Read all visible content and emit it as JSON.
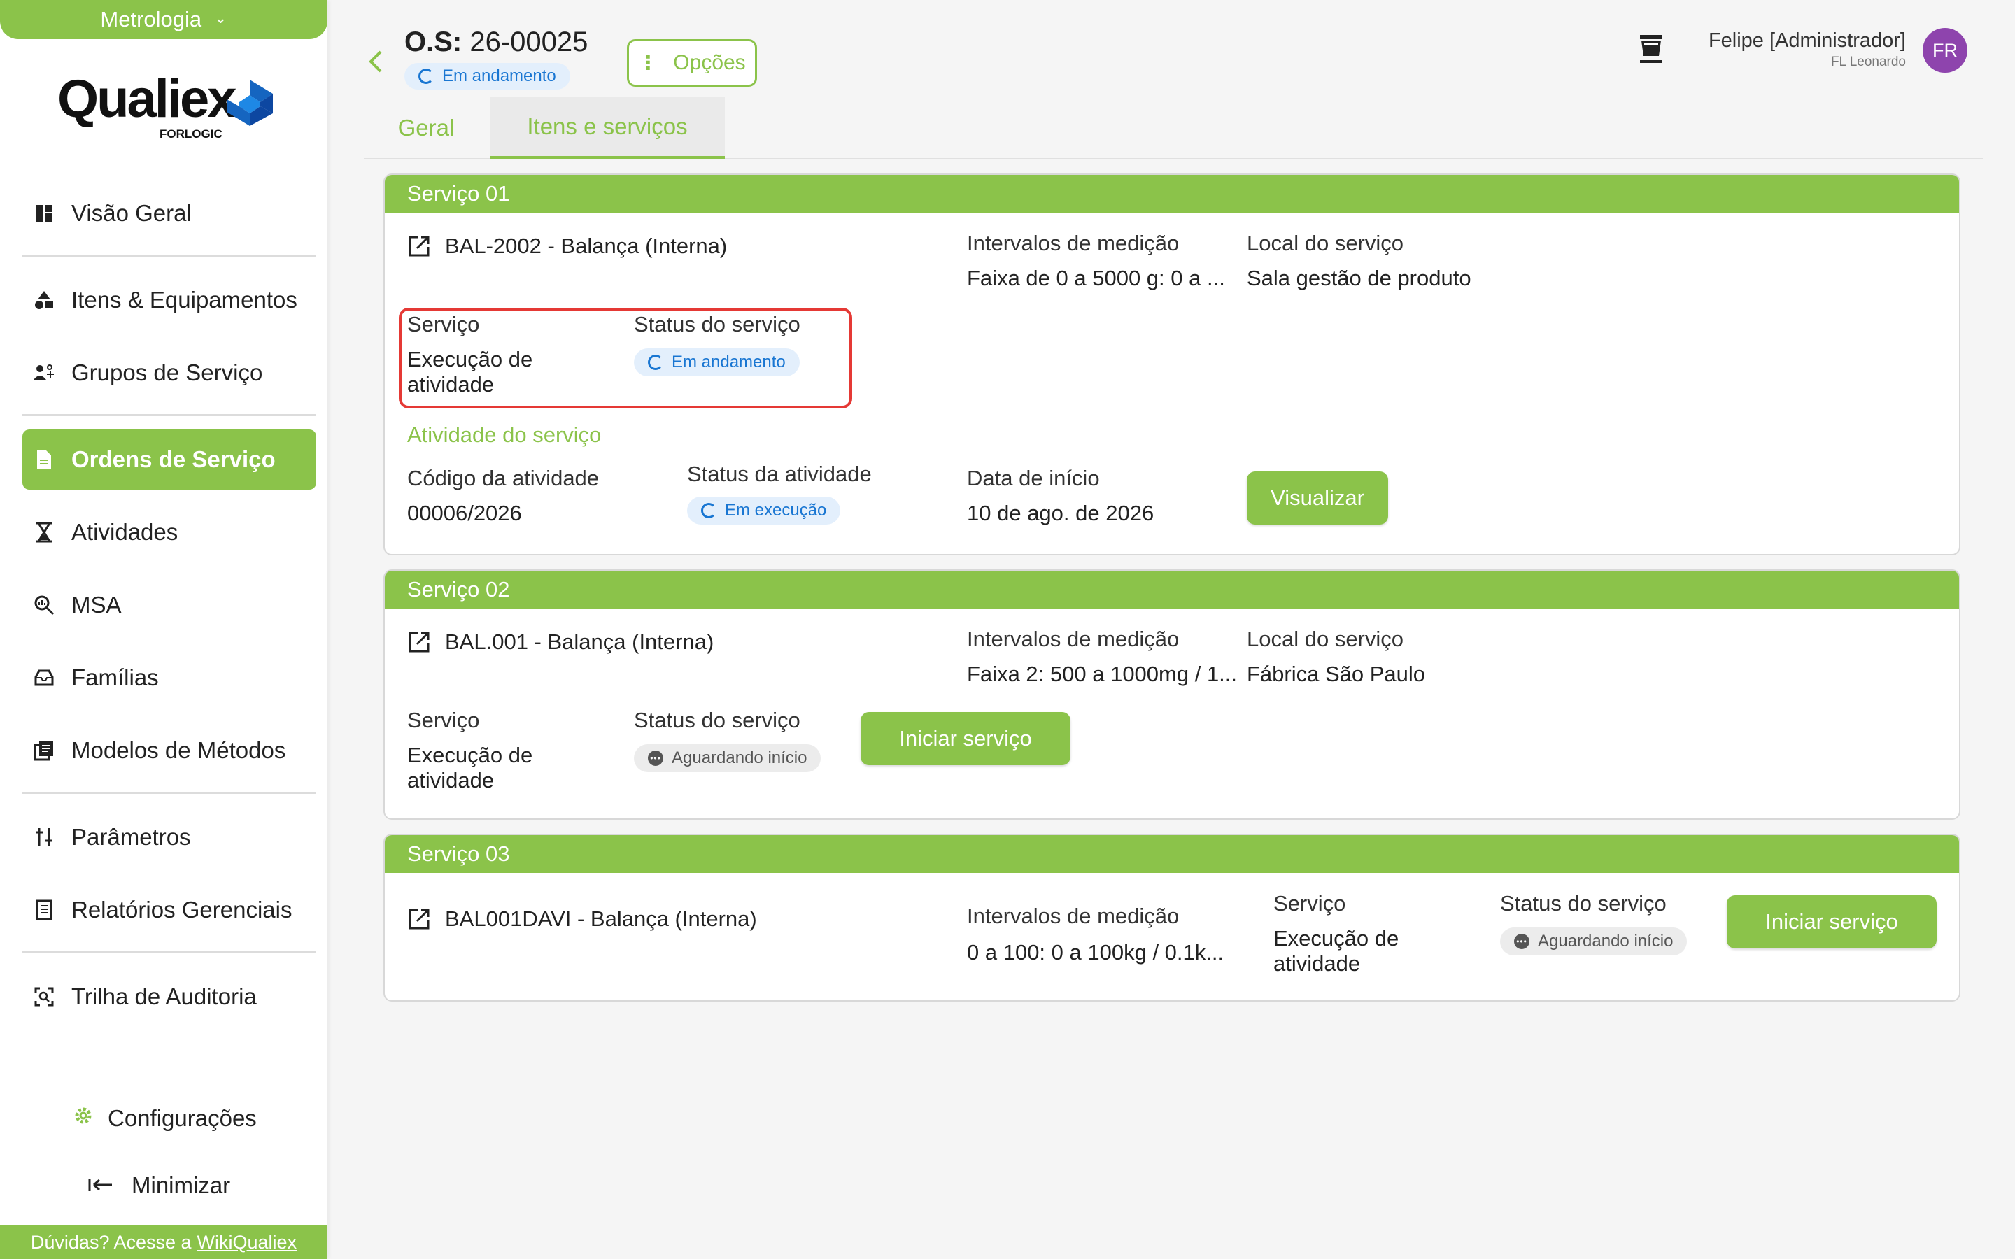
{
  "sidebar": {
    "module": "Metrologia",
    "logo": {
      "word": "Qualiex",
      "sub": "FORLOGIC"
    },
    "items": [
      {
        "label": "Visão Geral",
        "icon": "dashboard-icon"
      },
      {
        "label": "Itens & Equipamentos",
        "icon": "shapes-icon"
      },
      {
        "label": "Grupos de Serviço",
        "icon": "group-icon"
      },
      {
        "label": "Ordens de Serviço",
        "icon": "document-icon",
        "active": true
      },
      {
        "label": "Atividades",
        "icon": "hourglass-icon"
      },
      {
        "label": "MSA",
        "icon": "search-analytics-icon"
      },
      {
        "label": "Famílias",
        "icon": "inbox-icon"
      },
      {
        "label": "Modelos de Métodos",
        "icon": "library-icon"
      },
      {
        "label": "Parâmetros",
        "icon": "sliders-icon"
      },
      {
        "label": "Relatórios Gerenciais",
        "icon": "report-icon"
      },
      {
        "label": "Trilha de Auditoria",
        "icon": "audit-icon"
      }
    ],
    "config": "Configurações",
    "minimize": "Minimizar",
    "help_text": "Dúvidas? Acesse a",
    "help_link": "WikiQualiex"
  },
  "header": {
    "os_label": "O.S:",
    "os_number": "26-00025",
    "status": "Em andamento",
    "options": "Opções",
    "user_name": "Felipe [Administrador]",
    "user_sub": "FL Leonardo",
    "avatar": "FR"
  },
  "tabs": [
    "Geral",
    "Itens e serviços"
  ],
  "labels": {
    "intervalos": "Intervalos de medição",
    "local": "Local do serviço",
    "servico": "Serviço",
    "status_servico": "Status do serviço",
    "atividade_titulo": "Atividade do serviço",
    "codigo_atividade": "Código da atividade",
    "status_atividade": "Status da atividade",
    "data_inicio": "Data de início"
  },
  "services": [
    {
      "title": "Serviço 01",
      "item": "BAL-2002 - Balança (Interna)",
      "interval": "Faixa de 0 a 5000 g: 0 a ...",
      "local": "Sala gestão de produto",
      "service_type": [
        "Execução de",
        "atividade"
      ],
      "status": "Em andamento",
      "activity": {
        "code": "00006/2026",
        "status": "Em execução",
        "start_date": "10 de ago. de 2026",
        "action": "Visualizar"
      }
    },
    {
      "title": "Serviço 02",
      "item": "BAL.001 - Balança (Interna)",
      "interval": "Faixa 2: 500 a 1000mg / 1...",
      "local": "Fábrica São Paulo",
      "service_type": [
        "Execução de",
        "atividade"
      ],
      "status": "Aguardando início",
      "action": "Iniciar serviço"
    },
    {
      "title": "Serviço 03",
      "item": "BAL001DAVI - Balança (Interna)",
      "interval": "0 a 100: 0 a 100kg / 0.1k...",
      "service_type": [
        "Execução de",
        "atividade"
      ],
      "status": "Aguardando início",
      "action": "Iniciar serviço"
    }
  ],
  "colors": {
    "accent": "#8bc34a",
    "info": "#1976d2",
    "highlight": "#e53935",
    "avatar": "#8e44ad"
  }
}
